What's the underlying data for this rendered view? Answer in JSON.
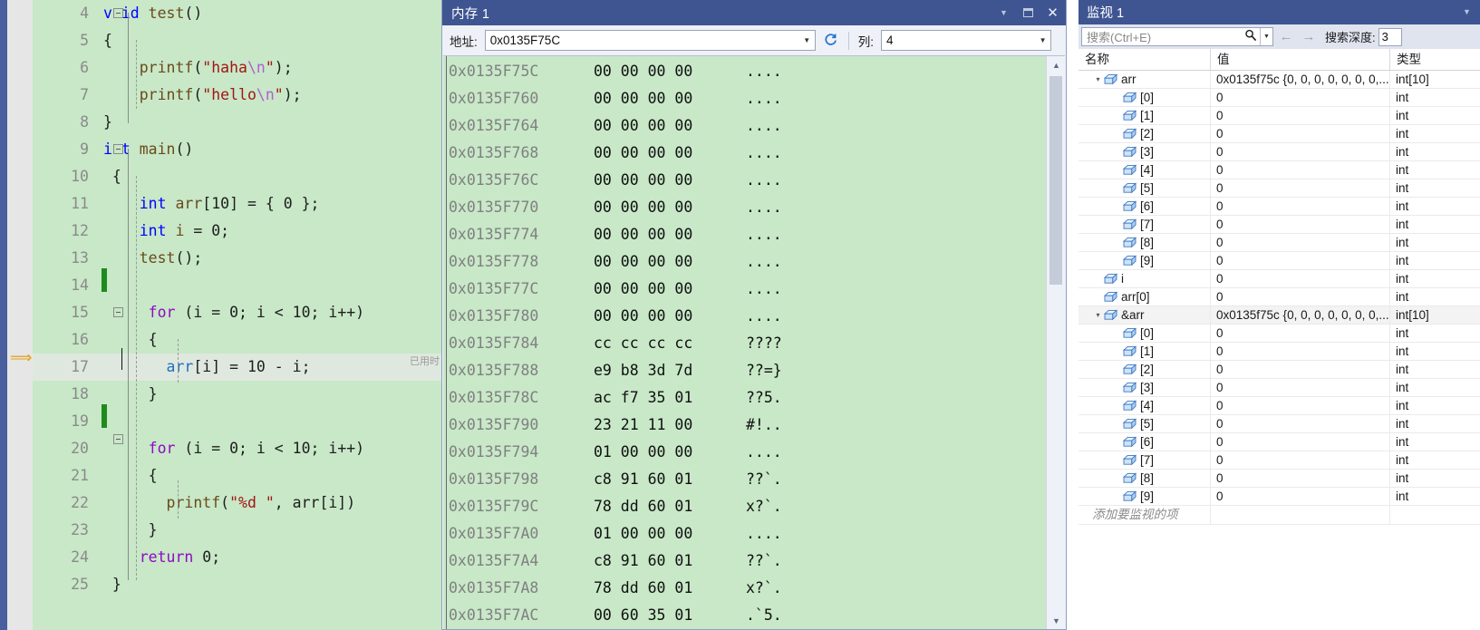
{
  "editor": {
    "name": "source-code-editor",
    "current_line": 17,
    "elapsed_label": "已用时",
    "lines": [
      {
        "n": "4",
        "tokens": [
          {
            "t": "void",
            "c": "kw"
          },
          {
            "t": " test",
            "c": "fn"
          },
          {
            "t": "()",
            "c": "plain"
          }
        ]
      },
      {
        "n": "5",
        "tokens": [
          {
            "t": "{",
            "c": "plain"
          }
        ]
      },
      {
        "n": "6",
        "tokens": [
          {
            "t": "    printf",
            "c": "fn"
          },
          {
            "t": "(",
            "c": "plain"
          },
          {
            "t": "\"haha",
            "c": "str"
          },
          {
            "t": "\\n",
            "c": "esc"
          },
          {
            "t": "\"",
            "c": "str"
          },
          {
            "t": ");",
            "c": "plain"
          }
        ]
      },
      {
        "n": "7",
        "tokens": [
          {
            "t": "    printf",
            "c": "fn"
          },
          {
            "t": "(",
            "c": "plain"
          },
          {
            "t": "\"hello",
            "c": "str"
          },
          {
            "t": "\\n",
            "c": "esc"
          },
          {
            "t": "\"",
            "c": "str"
          },
          {
            "t": ");",
            "c": "plain"
          }
        ]
      },
      {
        "n": "8",
        "tokens": [
          {
            "t": "}",
            "c": "plain"
          }
        ]
      },
      {
        "n": "9",
        "tokens": [
          {
            "t": "int",
            "c": "kw"
          },
          {
            "t": " main",
            "c": "fn"
          },
          {
            "t": "()",
            "c": "plain"
          }
        ]
      },
      {
        "n": "10",
        "tokens": [
          {
            "t": " {",
            "c": "plain"
          }
        ]
      },
      {
        "n": "11",
        "tokens": [
          {
            "t": "    int",
            "c": "kw"
          },
          {
            "t": " arr",
            "c": "fn"
          },
          {
            "t": "[",
            "c": "plain"
          },
          {
            "t": "10",
            "c": "num"
          },
          {
            "t": "] = { ",
            "c": "plain"
          },
          {
            "t": "0",
            "c": "num"
          },
          {
            "t": " };",
            "c": "plain"
          }
        ]
      },
      {
        "n": "12",
        "tokens": [
          {
            "t": "    int",
            "c": "kw"
          },
          {
            "t": " i",
            "c": "fn"
          },
          {
            "t": " = ",
            "c": "plain"
          },
          {
            "t": "0",
            "c": "num"
          },
          {
            "t": ";",
            "c": "plain"
          }
        ]
      },
      {
        "n": "13",
        "tokens": [
          {
            "t": "    test",
            "c": "fn"
          },
          {
            "t": "();",
            "c": "plain"
          }
        ]
      },
      {
        "n": "14",
        "tokens": [
          {
            "t": "",
            "c": "plain"
          }
        ]
      },
      {
        "n": "15",
        "tokens": [
          {
            "t": "     for",
            "c": "kw2"
          },
          {
            "t": " (i = ",
            "c": "plain"
          },
          {
            "t": "0",
            "c": "num"
          },
          {
            "t": "; i < ",
            "c": "plain"
          },
          {
            "t": "10",
            "c": "num"
          },
          {
            "t": "; i++)",
            "c": "plain"
          }
        ]
      },
      {
        "n": "16",
        "tokens": [
          {
            "t": "     {",
            "c": "plain"
          }
        ]
      },
      {
        "n": "17",
        "tokens": [
          {
            "t": "       arr",
            "c": "id"
          },
          {
            "t": "[i] = ",
            "c": "plain"
          },
          {
            "t": "10",
            "c": "num"
          },
          {
            "t": " - i;",
            "c": "plain"
          }
        ]
      },
      {
        "n": "18",
        "tokens": [
          {
            "t": "     }",
            "c": "plain"
          }
        ]
      },
      {
        "n": "19",
        "tokens": [
          {
            "t": "",
            "c": "plain"
          }
        ]
      },
      {
        "n": "20",
        "tokens": [
          {
            "t": "     for",
            "c": "kw2"
          },
          {
            "t": " (i = ",
            "c": "plain"
          },
          {
            "t": "0",
            "c": "num"
          },
          {
            "t": "; i < ",
            "c": "plain"
          },
          {
            "t": "10",
            "c": "num"
          },
          {
            "t": "; i++)",
            "c": "plain"
          }
        ]
      },
      {
        "n": "21",
        "tokens": [
          {
            "t": "     {",
            "c": "plain"
          }
        ]
      },
      {
        "n": "22",
        "tokens": [
          {
            "t": "       printf",
            "c": "fn"
          },
          {
            "t": "(",
            "c": "plain"
          },
          {
            "t": "\"%d ",
            "c": "str"
          },
          {
            "t": "\"",
            "c": "str"
          },
          {
            "t": ", arr",
            "c": "plain"
          },
          {
            "t": "[i])",
            "c": "plain"
          }
        ]
      },
      {
        "n": "23",
        "tokens": [
          {
            "t": "     }",
            "c": "plain"
          }
        ]
      },
      {
        "n": "24",
        "tokens": [
          {
            "t": "    return",
            "c": "kw2"
          },
          {
            "t": " ",
            "c": "plain"
          },
          {
            "t": "0",
            "c": "num"
          },
          {
            "t": ";",
            "c": "plain"
          }
        ]
      },
      {
        "n": "25",
        "tokens": [
          {
            "t": " }",
            "c": "plain"
          }
        ]
      }
    ]
  },
  "memory": {
    "title": "内存 1",
    "address_label": "地址:",
    "address_value": "0x0135F75C",
    "columns_label": "列:",
    "columns_value": "4",
    "refresh_icon": "refresh-icon",
    "titlebar_icons": [
      "chevron-down-icon",
      "maximize-icon",
      "close-icon"
    ],
    "rows": [
      {
        "addr": "0x0135F75C",
        "hex": "00 00 00 00",
        "ascii": "...."
      },
      {
        "addr": "0x0135F760",
        "hex": "00 00 00 00",
        "ascii": "...."
      },
      {
        "addr": "0x0135F764",
        "hex": "00 00 00 00",
        "ascii": "...."
      },
      {
        "addr": "0x0135F768",
        "hex": "00 00 00 00",
        "ascii": "...."
      },
      {
        "addr": "0x0135F76C",
        "hex": "00 00 00 00",
        "ascii": "...."
      },
      {
        "addr": "0x0135F770",
        "hex": "00 00 00 00",
        "ascii": "...."
      },
      {
        "addr": "0x0135F774",
        "hex": "00 00 00 00",
        "ascii": "...."
      },
      {
        "addr": "0x0135F778",
        "hex": "00 00 00 00",
        "ascii": "...."
      },
      {
        "addr": "0x0135F77C",
        "hex": "00 00 00 00",
        "ascii": "...."
      },
      {
        "addr": "0x0135F780",
        "hex": "00 00 00 00",
        "ascii": "...."
      },
      {
        "addr": "0x0135F784",
        "hex": "cc cc cc cc",
        "ascii": "????"
      },
      {
        "addr": "0x0135F788",
        "hex": "e9 b8 3d 7d",
        "ascii": "??=}"
      },
      {
        "addr": "0x0135F78C",
        "hex": "ac f7 35 01",
        "ascii": "??5."
      },
      {
        "addr": "0x0135F790",
        "hex": "23 21 11 00",
        "ascii": "#!.."
      },
      {
        "addr": "0x0135F794",
        "hex": "01 00 00 00",
        "ascii": "...."
      },
      {
        "addr": "0x0135F798",
        "hex": "c8 91 60 01",
        "ascii": "??`."
      },
      {
        "addr": "0x0135F79C",
        "hex": "78 dd 60 01",
        "ascii": "x?`."
      },
      {
        "addr": "0x0135F7A0",
        "hex": "01 00 00 00",
        "ascii": "...."
      },
      {
        "addr": "0x0135F7A4",
        "hex": "c8 91 60 01",
        "ascii": "??`."
      },
      {
        "addr": "0x0135F7A8",
        "hex": "78 dd 60 01",
        "ascii": "x?`."
      },
      {
        "addr": "0x0135F7AC",
        "hex": "00 60 35 01",
        "ascii": ".`5."
      }
    ]
  },
  "watch": {
    "title": "监视 1",
    "search_placeholder": "搜索(Ctrl+E)",
    "search_icon": "search-icon",
    "back_icon": "arrow-left-icon",
    "forward_icon": "arrow-right-icon",
    "depth_label": "搜索深度:",
    "depth_value": "3",
    "headers": {
      "name": "名称",
      "value": "值",
      "type": "类型"
    },
    "add_row_placeholder": "添加要监视的项",
    "rows": [
      {
        "name": "arr",
        "value": "0x0135f75c {0, 0, 0, 0, 0, 0, 0,...",
        "type": "int[10]",
        "indent": 0,
        "expander": "expanded",
        "selected": false
      },
      {
        "name": "[0]",
        "value": "0",
        "type": "int",
        "indent": 1,
        "expander": "none",
        "selected": false
      },
      {
        "name": "[1]",
        "value": "0",
        "type": "int",
        "indent": 1,
        "expander": "none",
        "selected": false
      },
      {
        "name": "[2]",
        "value": "0",
        "type": "int",
        "indent": 1,
        "expander": "none",
        "selected": false
      },
      {
        "name": "[3]",
        "value": "0",
        "type": "int",
        "indent": 1,
        "expander": "none",
        "selected": false
      },
      {
        "name": "[4]",
        "value": "0",
        "type": "int",
        "indent": 1,
        "expander": "none",
        "selected": false
      },
      {
        "name": "[5]",
        "value": "0",
        "type": "int",
        "indent": 1,
        "expander": "none",
        "selected": false
      },
      {
        "name": "[6]",
        "value": "0",
        "type": "int",
        "indent": 1,
        "expander": "none",
        "selected": false
      },
      {
        "name": "[7]",
        "value": "0",
        "type": "int",
        "indent": 1,
        "expander": "none",
        "selected": false
      },
      {
        "name": "[8]",
        "value": "0",
        "type": "int",
        "indent": 1,
        "expander": "none",
        "selected": false
      },
      {
        "name": "[9]",
        "value": "0",
        "type": "int",
        "indent": 1,
        "expander": "none",
        "selected": false
      },
      {
        "name": "i",
        "value": "0",
        "type": "int",
        "indent": 0,
        "expander": "none",
        "selected": false
      },
      {
        "name": "arr[0]",
        "value": "0",
        "type": "int",
        "indent": 0,
        "expander": "none",
        "selected": false
      },
      {
        "name": "&arr",
        "value": "0x0135f75c {0, 0, 0, 0, 0, 0, 0,...",
        "type": "int[10]",
        "indent": 0,
        "expander": "expanded",
        "selected": true
      },
      {
        "name": "[0]",
        "value": "0",
        "type": "int",
        "indent": 1,
        "expander": "none",
        "selected": false
      },
      {
        "name": "[1]",
        "value": "0",
        "type": "int",
        "indent": 1,
        "expander": "none",
        "selected": false
      },
      {
        "name": "[2]",
        "value": "0",
        "type": "int",
        "indent": 1,
        "expander": "none",
        "selected": false
      },
      {
        "name": "[3]",
        "value": "0",
        "type": "int",
        "indent": 1,
        "expander": "none",
        "selected": false
      },
      {
        "name": "[4]",
        "value": "0",
        "type": "int",
        "indent": 1,
        "expander": "none",
        "selected": false
      },
      {
        "name": "[5]",
        "value": "0",
        "type": "int",
        "indent": 1,
        "expander": "none",
        "selected": false
      },
      {
        "name": "[6]",
        "value": "0",
        "type": "int",
        "indent": 1,
        "expander": "none",
        "selected": false
      },
      {
        "name": "[7]",
        "value": "0",
        "type": "int",
        "indent": 1,
        "expander": "none",
        "selected": false
      },
      {
        "name": "[8]",
        "value": "0",
        "type": "int",
        "indent": 1,
        "expander": "none",
        "selected": false
      },
      {
        "name": "[9]",
        "value": "0",
        "type": "int",
        "indent": 1,
        "expander": "none",
        "selected": false
      }
    ]
  },
  "colors": {
    "titlebar": "#3f5592",
    "editor_bg": "#c8e8c8",
    "memory_bg": "#c8e8c8",
    "toolbar_bg": "#eef1f7",
    "changebar_green": "#1f8a1f",
    "arrow_yellow": "#e8a317"
  }
}
